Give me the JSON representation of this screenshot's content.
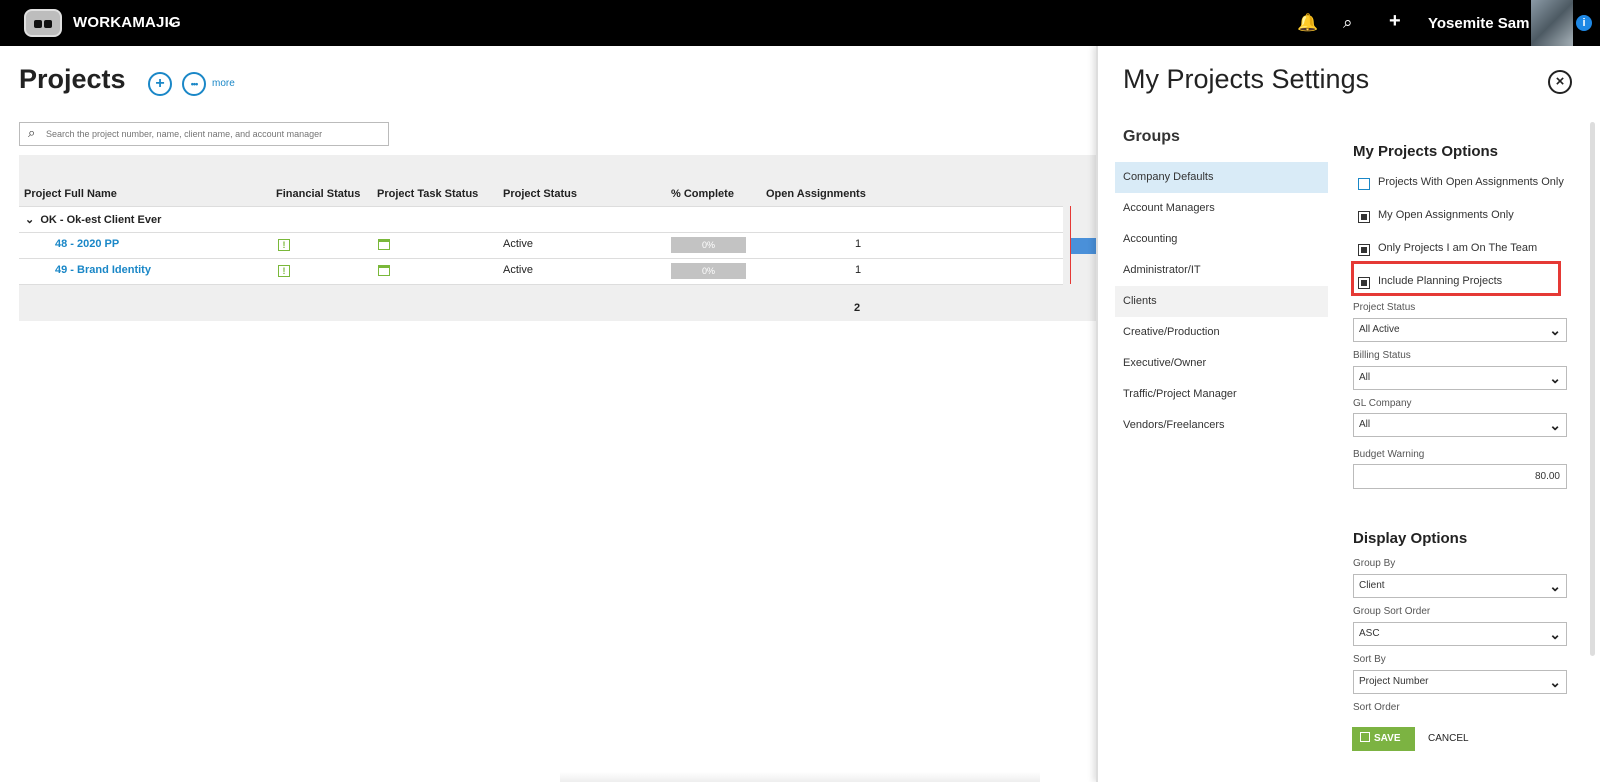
{
  "topbar": {
    "brand": "WORKAMAJIG",
    "user_name": "Yosemite Sam",
    "info": "i"
  },
  "projects": {
    "title": "Projects",
    "add_symbol": "+",
    "more_symbol": "•••",
    "more_label": "more",
    "search_placeholder": "Search the project number, name, client name, and account manager",
    "columns": [
      "Project Full Name",
      "Financial Status",
      "Project Task Status",
      "Project Status",
      "% Complete",
      "Open Assignments"
    ],
    "group_name": "OK - Ok-est Client Ever",
    "rows": [
      {
        "name": "48 - 2020 PP",
        "financial": "!",
        "status": "Active",
        "percent": "0%",
        "open": "1"
      },
      {
        "name": "49 - Brand Identity",
        "financial": "!",
        "status": "Active",
        "percent": "0%",
        "open": "1"
      }
    ],
    "total_open": "2"
  },
  "settings": {
    "title": "My Projects Settings",
    "close_symbol": "×",
    "groups_title": "Groups",
    "groups": [
      "Company Defaults",
      "Account Managers",
      "Accounting",
      "Administrator/IT",
      "Clients",
      "Creative/Production",
      "Executive/Owner",
      "Traffic/Project Manager",
      "Vendors/Freelancers"
    ],
    "options_title": "My Projects Options",
    "options": [
      {
        "label": "Projects With Open Assignments Only",
        "checked": false
      },
      {
        "label": "My Open Assignments Only",
        "checked": true
      },
      {
        "label": "Only Projects I am On The Team",
        "checked": true
      },
      {
        "label": "Include Planning Projects",
        "checked": true
      }
    ],
    "project_status_label": "Project Status",
    "project_status_value": "All Active",
    "billing_status_label": "Billing Status",
    "billing_status_value": "All",
    "gl_company_label": "GL Company",
    "gl_company_value": "All",
    "budget_warning_label": "Budget Warning",
    "budget_warning_value": "80.00",
    "display_title": "Display Options",
    "group_by_label": "Group By",
    "group_by_value": "Client",
    "group_sort_label": "Group Sort Order",
    "group_sort_value": "ASC",
    "sort_by_label": "Sort By",
    "sort_by_value": "Project Number",
    "sort_order_label": "Sort Order",
    "save_label": "SAVE",
    "cancel_label": "CANCEL"
  }
}
